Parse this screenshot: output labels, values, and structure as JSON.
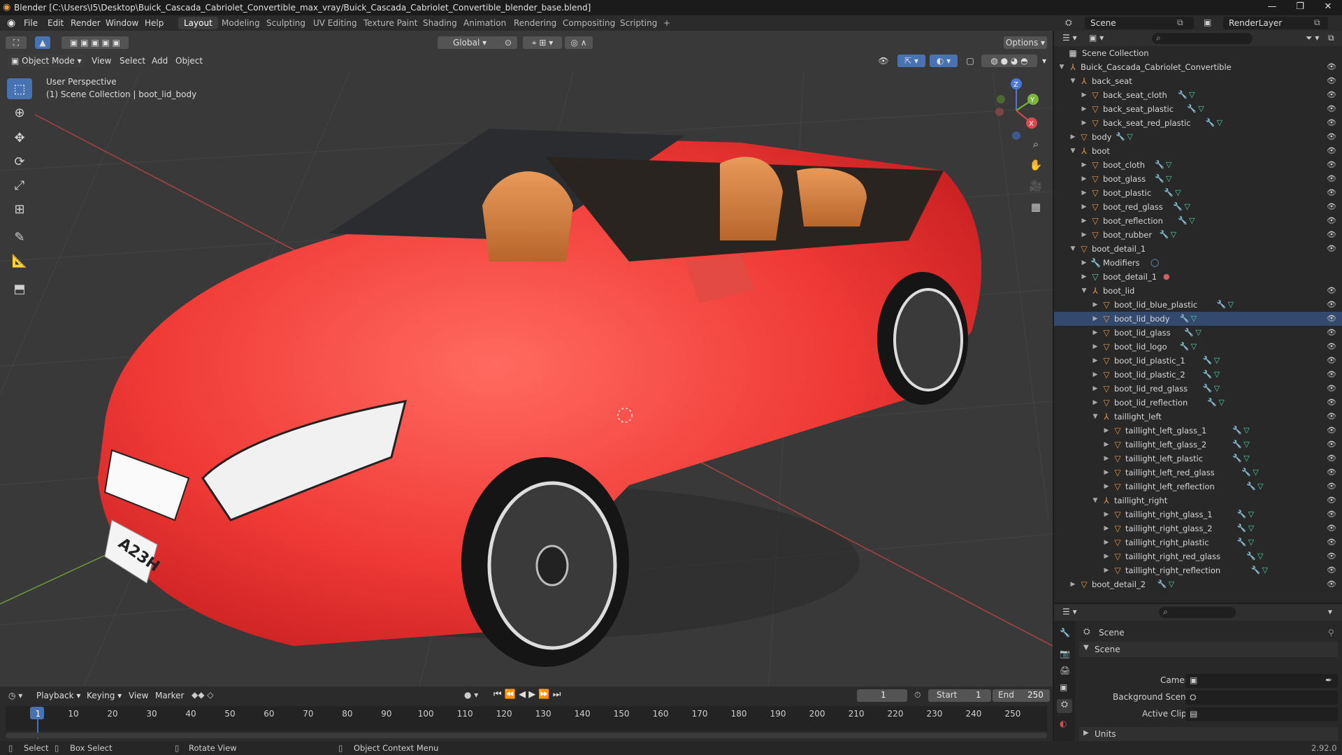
{
  "window": {
    "title": "Blender [C:\\Users\\I5\\Desktop\\Buick_Cascada_Cabriolet_Convertible_max_vray/Buick_Cascada_Cabriolet_Convertible_blender_base.blend]",
    "controls": [
      "—",
      "❐",
      "✕"
    ]
  },
  "menus": [
    "File",
    "Edit",
    "Render",
    "Window",
    "Help"
  ],
  "workspaces": [
    "Layout",
    "Modeling",
    "Sculpting",
    "UV Editing",
    "Texture Paint",
    "Shading",
    "Animation",
    "Rendering",
    "Compositing",
    "Scripting",
    "+"
  ],
  "active_workspace": "Layout",
  "top_right": {
    "scene": "Scene",
    "render_layer": "RenderLayer"
  },
  "viewport": {
    "transform": "Global",
    "options": "Options",
    "mode": "Object Mode",
    "menus": [
      "View",
      "Select",
      "Add",
      "Object"
    ],
    "perspective": "User Perspective",
    "collection_info": "(1) Scene Collection | boot_lid_body",
    "plate_text": "A23H",
    "gizmo_axes": [
      "X",
      "Y",
      "Z"
    ]
  },
  "toolbar_icons": [
    "select-box-icon",
    "cursor-icon",
    "move-icon",
    "rotate-icon",
    "scale-icon",
    "transform-icon",
    "annotate-icon",
    "measure-icon",
    "add-cube-icon"
  ],
  "outliner": {
    "root": "Scene Collection",
    "rows": [
      {
        "label": "Buick_Cascada_Cabriolet_Convertible",
        "depth": 0,
        "arrow": "▼",
        "type": "empty",
        "mod": false,
        "mesh": false
      },
      {
        "label": "back_seat",
        "depth": 1,
        "arrow": "▼",
        "type": "empty",
        "mod": false,
        "mesh": false
      },
      {
        "label": "back_seat_cloth",
        "depth": 2,
        "arrow": "▶",
        "type": "mesh",
        "mod": true,
        "mesh": true
      },
      {
        "label": "back_seat_plastic",
        "depth": 2,
        "arrow": "▶",
        "type": "mesh",
        "mod": true,
        "mesh": true
      },
      {
        "label": "back_seat_red_plastic",
        "depth": 2,
        "arrow": "▶",
        "type": "mesh",
        "mod": true,
        "mesh": true
      },
      {
        "label": "body",
        "depth": 1,
        "arrow": "▶",
        "type": "mesh",
        "mod": true,
        "mesh": true
      },
      {
        "label": "boot",
        "depth": 1,
        "arrow": "▼",
        "type": "empty",
        "mod": false,
        "mesh": false
      },
      {
        "label": "boot_cloth",
        "depth": 2,
        "arrow": "▶",
        "type": "mesh",
        "mod": true,
        "mesh": true
      },
      {
        "label": "boot_glass",
        "depth": 2,
        "arrow": "▶",
        "type": "mesh",
        "mod": true,
        "mesh": true
      },
      {
        "label": "boot_plastic",
        "depth": 2,
        "arrow": "▶",
        "type": "mesh",
        "mod": true,
        "mesh": true
      },
      {
        "label": "boot_red_glass",
        "depth": 2,
        "arrow": "▶",
        "type": "mesh",
        "mod": true,
        "mesh": true
      },
      {
        "label": "boot_reflection",
        "depth": 2,
        "arrow": "▶",
        "type": "mesh",
        "mod": true,
        "mesh": true
      },
      {
        "label": "boot_rubber",
        "depth": 2,
        "arrow": "▶",
        "type": "mesh",
        "mod": true,
        "mesh": true
      },
      {
        "label": "boot_detail_1",
        "depth": 1,
        "arrow": "▼",
        "type": "mesh",
        "mod": false,
        "mesh": false
      },
      {
        "label": "Modifiers",
        "depth": 2,
        "arrow": "▶",
        "type": "modifier",
        "mod": false,
        "mesh": false
      },
      {
        "label": "boot_detail_1",
        "depth": 2,
        "arrow": "▶",
        "type": "meshdata",
        "mod": false,
        "mesh": false
      },
      {
        "label": "boot_lid",
        "depth": 2,
        "arrow": "▼",
        "type": "empty",
        "mod": false,
        "mesh": false
      },
      {
        "label": "boot_lid_blue_plastic",
        "depth": 3,
        "arrow": "▶",
        "type": "mesh",
        "mod": true,
        "mesh": true
      },
      {
        "label": "boot_lid_body",
        "depth": 3,
        "arrow": "▶",
        "type": "mesh",
        "mod": true,
        "mesh": true
      },
      {
        "label": "boot_lid_glass",
        "depth": 3,
        "arrow": "▶",
        "type": "mesh",
        "mod": true,
        "mesh": true
      },
      {
        "label": "boot_lid_logo",
        "depth": 3,
        "arrow": "▶",
        "type": "mesh",
        "mod": true,
        "mesh": true
      },
      {
        "label": "boot_lid_plastic_1",
        "depth": 3,
        "arrow": "▶",
        "type": "mesh",
        "mod": true,
        "mesh": true
      },
      {
        "label": "boot_lid_plastic_2",
        "depth": 3,
        "arrow": "▶",
        "type": "mesh",
        "mod": true,
        "mesh": true
      },
      {
        "label": "boot_lid_red_glass",
        "depth": 3,
        "arrow": "▶",
        "type": "mesh",
        "mod": true,
        "mesh": true
      },
      {
        "label": "boot_lid_reflection",
        "depth": 3,
        "arrow": "▶",
        "type": "mesh",
        "mod": true,
        "mesh": true
      },
      {
        "label": "taillight_left",
        "depth": 3,
        "arrow": "▼",
        "type": "empty",
        "mod": false,
        "mesh": false
      },
      {
        "label": "taillight_left_glass_1",
        "depth": 4,
        "arrow": "▶",
        "type": "mesh",
        "mod": true,
        "mesh": true
      },
      {
        "label": "taillight_left_glass_2",
        "depth": 4,
        "arrow": "▶",
        "type": "mesh",
        "mod": true,
        "mesh": true
      },
      {
        "label": "taillight_left_plastic",
        "depth": 4,
        "arrow": "▶",
        "type": "mesh",
        "mod": true,
        "mesh": true
      },
      {
        "label": "taillight_left_red_glass",
        "depth": 4,
        "arrow": "▶",
        "type": "mesh",
        "mod": true,
        "mesh": true
      },
      {
        "label": "taillight_left_reflection",
        "depth": 4,
        "arrow": "▶",
        "type": "mesh",
        "mod": true,
        "mesh": true
      },
      {
        "label": "taillight_right",
        "depth": 3,
        "arrow": "▼",
        "type": "empty",
        "mod": false,
        "mesh": false
      },
      {
        "label": "taillight_right_glass_1",
        "depth": 4,
        "arrow": "▶",
        "type": "mesh",
        "mod": true,
        "mesh": true
      },
      {
        "label": "taillight_right_glass_2",
        "depth": 4,
        "arrow": "▶",
        "type": "mesh",
        "mod": true,
        "mesh": true
      },
      {
        "label": "taillight_right_plastic",
        "depth": 4,
        "arrow": "▶",
        "type": "mesh",
        "mod": true,
        "mesh": true
      },
      {
        "label": "taillight_right_red_glass",
        "depth": 4,
        "arrow": "▶",
        "type": "mesh",
        "mod": true,
        "mesh": true
      },
      {
        "label": "taillight_right_reflection",
        "depth": 4,
        "arrow": "▶",
        "type": "mesh",
        "mod": true,
        "mesh": true
      },
      {
        "label": "boot_detail_2",
        "depth": 1,
        "arrow": "▶",
        "type": "mesh",
        "mod": true,
        "mesh": true
      }
    ],
    "selected": "boot_lid_body"
  },
  "properties": {
    "header": "Scene",
    "section": "Scene",
    "fields": [
      {
        "label": "Camera",
        "value": ""
      },
      {
        "label": "Background Scene",
        "value": ""
      },
      {
        "label": "Active Clip",
        "value": ""
      }
    ],
    "collapsed_section": "Units",
    "version": "2.92.0"
  },
  "timeline": {
    "menus": [
      "Playback",
      "Keying",
      "View",
      "Marker"
    ],
    "current_frame": "1",
    "start_label": "Start",
    "start": "1",
    "end_label": "End",
    "end": "250",
    "ticks": [
      "1",
      "10",
      "20",
      "30",
      "40",
      "50",
      "60",
      "70",
      "80",
      "90",
      "100",
      "110",
      "120",
      "130",
      "140",
      "150",
      "160",
      "170",
      "180",
      "190",
      "200",
      "210",
      "220",
      "230",
      "240",
      "250"
    ]
  },
  "status": {
    "select": "Select",
    "box_select": "Box Select",
    "rotate_view": "Rotate View",
    "context_menu": "Object Context Menu"
  },
  "colors": {
    "accent": "#4772b3",
    "car_red": "#f0423f",
    "mesh_green": "#4fd0a0",
    "modifier_blue": "#6ea0d8",
    "empty_orange": "#e39a4a"
  }
}
